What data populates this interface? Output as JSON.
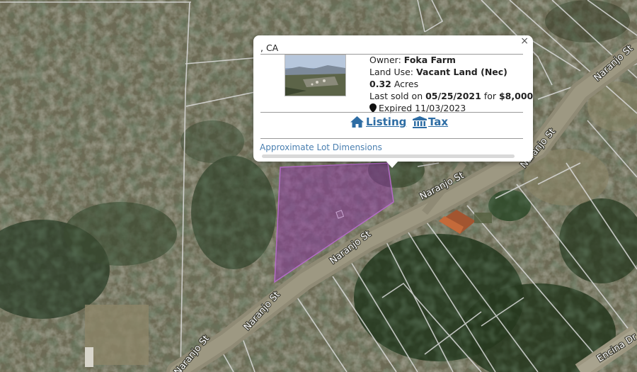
{
  "map": {
    "streets": [
      {
        "label": "Naranjo St"
      },
      {
        "label": "Naranjo St"
      },
      {
        "label": "Naranjo St"
      },
      {
        "label": "Naranjo St"
      },
      {
        "label": "Naranjo St"
      },
      {
        "label": "Naranjo St"
      },
      {
        "label": "Encina Dr"
      }
    ],
    "parcel_highlight_color": "#8b3a9e"
  },
  "popup": {
    "location": ", CA",
    "owner_label": "Owner:",
    "owner": "Foka Farm",
    "land_use_label": "Land Use:",
    "land_use": "Vacant Land (Nec)",
    "acres_value": "0.32",
    "acres_unit": "Acres",
    "last_sold_prefix": "Last sold on",
    "last_sold_date": "05/25/2021",
    "last_sold_for": "for",
    "last_sold_price": "$8,000",
    "status": "Expired 11/03/2023",
    "listing_label": "Listing",
    "tax_label": "Tax",
    "dimensions_label": "Approximate Lot Dimensions",
    "close_symbol": "×",
    "link_color": "#2e6da4"
  }
}
